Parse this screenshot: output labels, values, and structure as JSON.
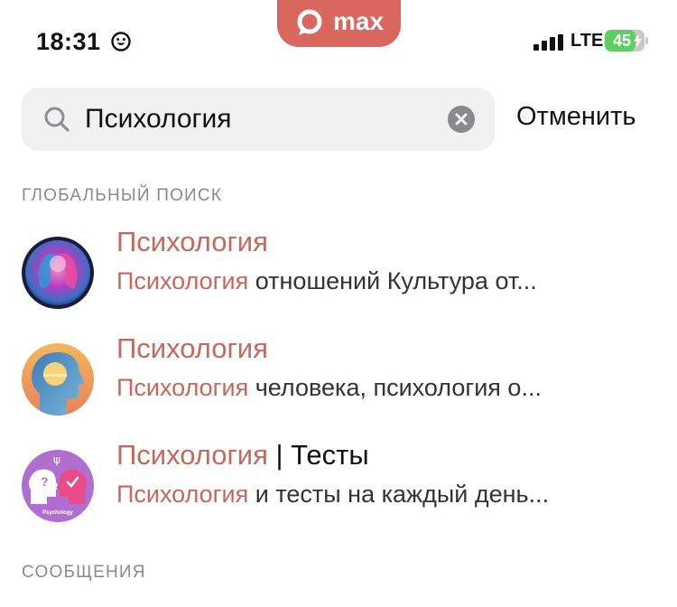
{
  "status_bar": {
    "time": "18:31",
    "app_brand": "max",
    "network": "LTE",
    "battery": "45",
    "icons": [
      "emoji-icon",
      "signal-icon",
      "battery-icon"
    ]
  },
  "search": {
    "value": "Психология",
    "placeholder": "",
    "cancel_label": "Отменить"
  },
  "sections": {
    "global": "ГЛОБАЛЬНЫЙ ПОИСК",
    "messages": "СООБЩЕНИЯ"
  },
  "results": [
    {
      "title_match": "Психология",
      "title_rest": "",
      "sub_match": "Психология",
      "sub_rest": " отношений Культура от..."
    },
    {
      "title_match": "Психология",
      "title_rest": "",
      "sub_match": "Психология",
      "sub_rest": " человека, психология о..."
    },
    {
      "title_match": "Психология",
      "title_rest": " | Тесты",
      "sub_match": "Психология",
      "sub_rest": " и тесты на каждый день...",
      "avatar_label": "Psychology"
    }
  ],
  "colors": {
    "accent": "#d9675e",
    "highlight": "#c6685c",
    "search_bg": "#f1f1f2",
    "section_text": "#8a8a8e",
    "battery_green": "#5ccf63"
  }
}
